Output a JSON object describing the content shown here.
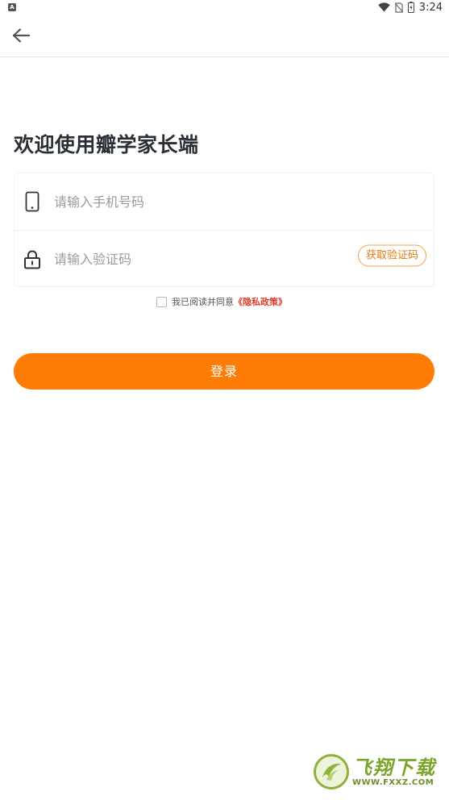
{
  "status_bar": {
    "notification_icon": "A",
    "time": "3:24",
    "icons": [
      "wifi-icon",
      "no-sim-icon",
      "battery-charging-icon"
    ]
  },
  "header": {
    "back_icon": "arrow-left-icon"
  },
  "title": "欢迎使用瓣学家长端",
  "form": {
    "phone_placeholder": "请输入手机号码",
    "phone_icon": "phone-icon",
    "code_placeholder": "请输入验证码",
    "code_icon": "lock-icon",
    "get_code_label": "获取验证码"
  },
  "agreement": {
    "checked": false,
    "text": "我已阅读并同意",
    "link": "《隐私政策》"
  },
  "login_label": "登录",
  "watermark": {
    "title": "飞翔下载",
    "url": "WWW.FXXZ.COM"
  },
  "colors": {
    "accent": "#ff7d06",
    "link_red": "#e03b2a",
    "code_button": "#e07b10"
  }
}
